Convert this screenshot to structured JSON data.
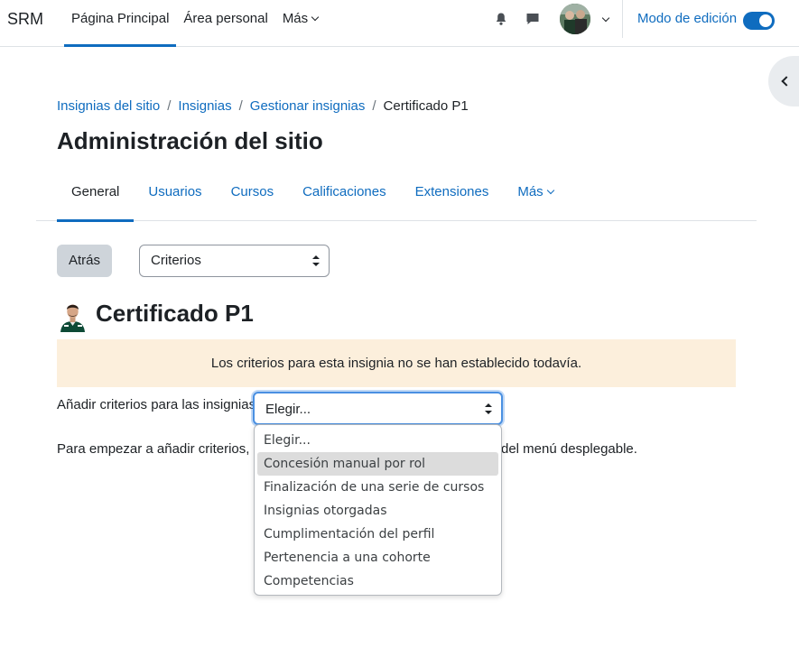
{
  "navbar": {
    "brand": "SRM",
    "items": [
      {
        "label": "Página Principal",
        "active": true
      },
      {
        "label": "Área personal",
        "active": false
      },
      {
        "label": "Más",
        "active": false
      }
    ],
    "edit_mode_label": "Modo de edición",
    "edit_mode_on": true
  },
  "breadcrumb": [
    {
      "label": "Insignias del sitio"
    },
    {
      "label": "Insignias"
    },
    {
      "label": "Gestionar insignias"
    },
    {
      "label": "Certificado P1"
    }
  ],
  "page_title": "Administración del sitio",
  "secondary_nav": {
    "tabs": [
      {
        "label": "General",
        "active": true
      },
      {
        "label": "Usuarios"
      },
      {
        "label": "Cursos"
      },
      {
        "label": "Calificaciones"
      },
      {
        "label": "Extensiones"
      },
      {
        "label": "Más"
      }
    ]
  },
  "toolbar": {
    "back_label": "Atrás",
    "criteria_select_value": "Criterios"
  },
  "badge": {
    "name": "Certificado P1"
  },
  "alert_text": "Los criterios para esta insignia no se han establecido todavía.",
  "add_criteria": {
    "label": "Añadir criterios para las insignias",
    "select_value": "Elegir...",
    "options": [
      "Elegir...",
      "Concesión manual por rol",
      "Finalización de una serie de cursos",
      "Insignias otorgadas",
      "Cumplimentación del perfil",
      "Pertenencia a una cohorte",
      "Competencias"
    ],
    "highlighted_option": "Concesión manual por rol"
  },
  "help_text": {
    "visible_start": "Para empezar a añadir criterios, p",
    "visible_end": "del menú desplegable."
  },
  "colors": {
    "link": "#0f6cbf",
    "alert_bg": "#fcefdc",
    "secondary_btn": "#ced4da"
  }
}
